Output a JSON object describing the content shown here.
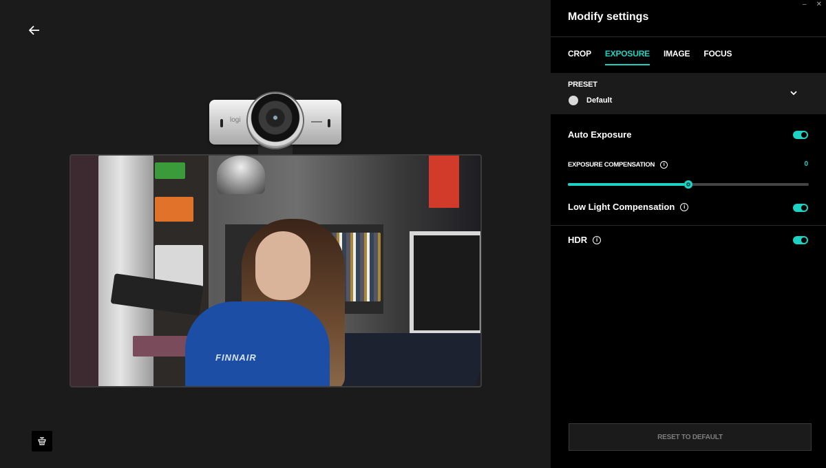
{
  "panel": {
    "title": "Modify settings",
    "tabs": [
      {
        "label": "CROP",
        "active": false
      },
      {
        "label": "EXPOSURE",
        "active": true
      },
      {
        "label": "IMAGE",
        "active": false
      },
      {
        "label": "FOCUS",
        "active": false
      }
    ],
    "preset": {
      "label": "PRESET",
      "value": "Default"
    },
    "auto_exposure": {
      "label": "Auto Exposure",
      "enabled": true
    },
    "exposure_compensation": {
      "label": "EXPOSURE COMPENSATION",
      "value": "0",
      "level": 0.5
    },
    "low_light": {
      "label": "Low Light Compensation",
      "enabled": true
    },
    "hdr": {
      "label": "HDR",
      "enabled": true
    },
    "reset_label": "RESET TO DEFAULT"
  },
  "window_controls": {
    "minimize": "–",
    "close": "✕"
  },
  "camera": {
    "logo": "logi",
    "shirt_text": "FINNAIR"
  },
  "colors": {
    "accent": "#1ed2c3",
    "panel_bg": "#000000",
    "preview_bg": "#1b1b1b"
  },
  "icons": {
    "back": "arrow-left-icon",
    "camera_menu": "camera-settings-icon",
    "info": "info-icon",
    "dropdown": "chevron-down-icon"
  }
}
